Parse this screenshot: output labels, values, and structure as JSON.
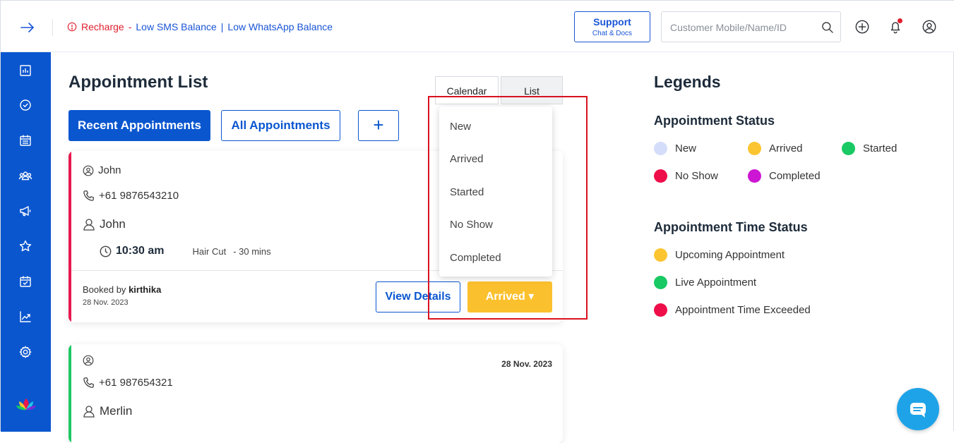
{
  "header": {
    "alert_recharge": "Recharge",
    "alert_dash": "-",
    "alert_sms": "Low SMS Balance",
    "alert_pipe": "|",
    "alert_whatsapp": "Low WhatsApp Balance",
    "support_label": "Support",
    "support_sub": "Chat & Docs",
    "search_placeholder": "Customer Mobile/Name/ID"
  },
  "sidebar": {
    "items": [
      "dashboard-icon",
      "check-circle-icon",
      "calendar-icon",
      "users-icon",
      "megaphone-icon",
      "star-icon",
      "calendar-check-icon",
      "trend-icon",
      "gear-icon"
    ]
  },
  "main": {
    "title": "Appointment List",
    "view_calendar": "Calendar",
    "view_list": "List",
    "btn_recent": "Recent Appointments",
    "btn_all": "All Appointments",
    "btn_add": "+"
  },
  "cards": [
    {
      "customer": "John",
      "phone": "+61 9876543210",
      "staff": "John",
      "time": "10:30 am",
      "service": "Hair Cut",
      "duration": "- 30 mins",
      "booked_label": "Booked by",
      "booked_by": "kirthika",
      "booked_date": "28 Nov. 2023",
      "view_label": "View Details",
      "status_label": "Arrived ▾",
      "stripe_color": "#e8184f"
    },
    {
      "customer": "",
      "phone": "+61 987654321",
      "staff": "Merlin",
      "date": "28 Nov. 2023",
      "stripe_color": "#1ec865"
    }
  ],
  "dropdown": {
    "options": [
      "New",
      "Arrived",
      "Started",
      "No Show",
      "Completed"
    ]
  },
  "legends": {
    "title": "Legends",
    "status_title": "Appointment Status",
    "status": [
      {
        "label": "New",
        "color": "#d4defa"
      },
      {
        "label": "Arrived",
        "color": "#fbc531"
      },
      {
        "label": "Started",
        "color": "#18c964"
      },
      {
        "label": "No Show",
        "color": "#ee0e4a"
      },
      {
        "label": "Completed",
        "color": "#cc16d4"
      }
    ],
    "time_title": "Appointment Time Status",
    "time": [
      {
        "label": "Upcoming Appointment",
        "color": "#fbc531"
      },
      {
        "label": "Live Appointment",
        "color": "#18c964"
      },
      {
        "label": "Appointment Time Exceeded",
        "color": "#ee0e4a"
      }
    ]
  },
  "colors": {
    "brand": "#0a56cf",
    "alert": "#e0202e",
    "arrived": "#fbc02d"
  }
}
